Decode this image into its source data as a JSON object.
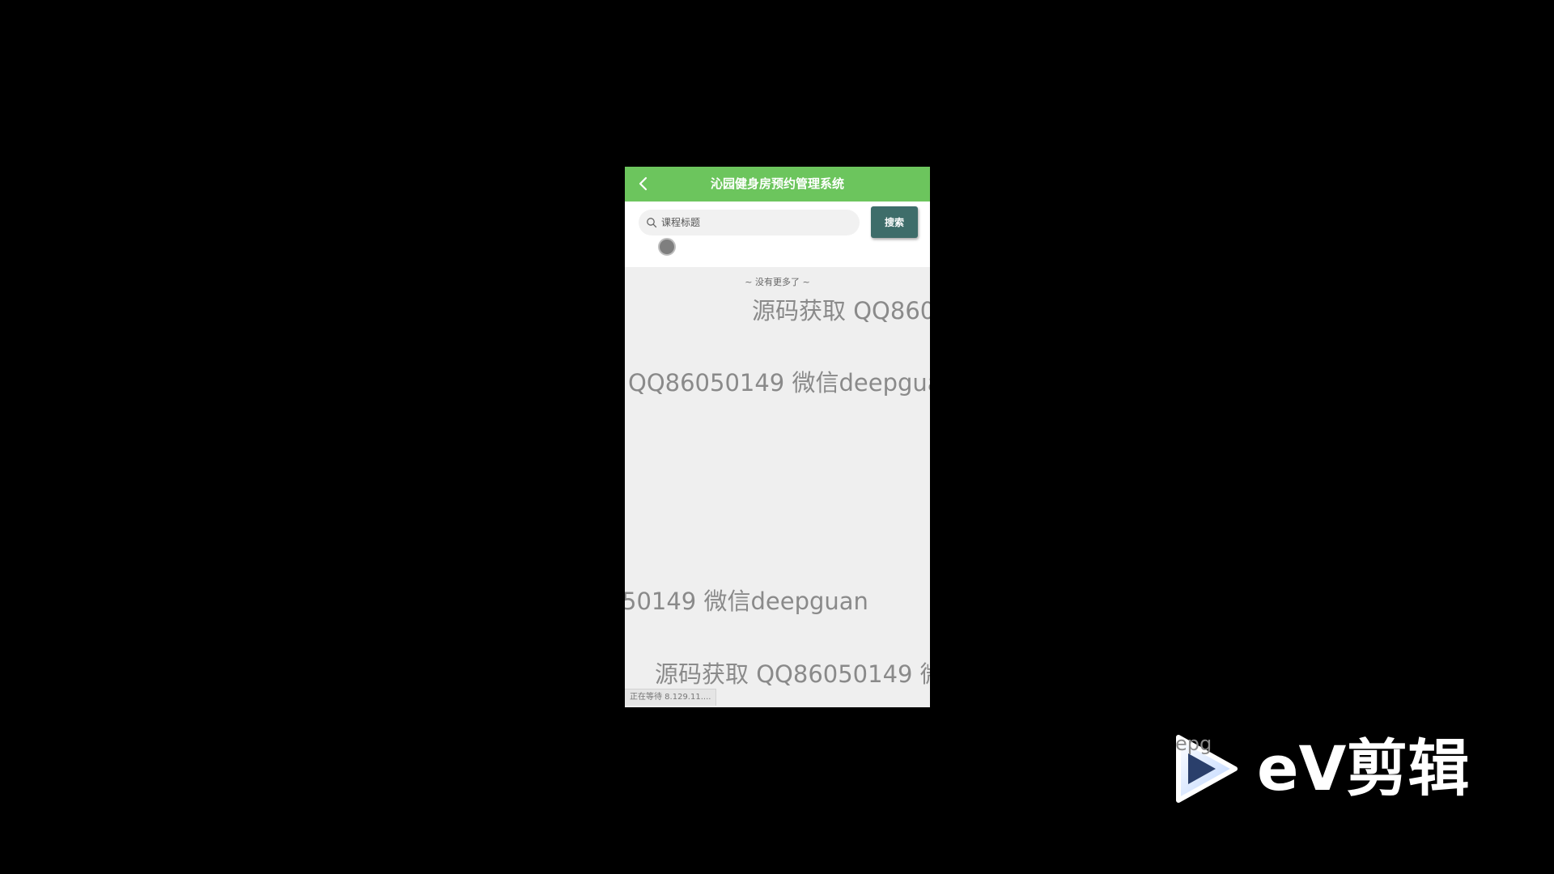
{
  "header": {
    "title": "沁园健身房预约管理系统"
  },
  "search": {
    "placeholder": "课程标题",
    "button_label": "搜索"
  },
  "list": {
    "end_text": "~ 没有更多了 ~"
  },
  "watermarks": [
    "源码获取  QQ860",
    "QQ86050149  微信deepgua",
    "50149  微信deepguan",
    "源码获取  QQ86050149  微"
  ],
  "status_bar": {
    "text": "正在等待 8.129.11...."
  },
  "brand": {
    "name": "eV剪辑",
    "watermark_fragment": "epg"
  },
  "colors": {
    "navbar": "#6cc55d",
    "search_button": "#3e6d6a",
    "background": "#efefef"
  }
}
